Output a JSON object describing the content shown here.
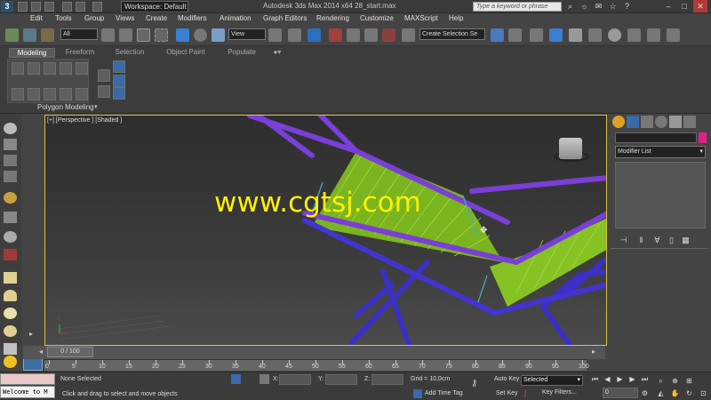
{
  "titlebar": {
    "workspace": "Workspace: Default",
    "title": "Autodesk 3ds Max  2014 x64      28_start.max",
    "search_placeholder": "Type a keyword or phrase"
  },
  "menu": [
    "Edit",
    "Tools",
    "Group",
    "Views",
    "Create",
    "Modifiers",
    "Animation",
    "Graph Editors",
    "Rendering",
    "Customize",
    "MAXScript",
    "Help"
  ],
  "toolbar": {
    "filter_select": "All",
    "view_select": "View",
    "named_selection": "Create Selection Se"
  },
  "ribbon": {
    "tabs": [
      "Modeling",
      "Freeform",
      "Selection",
      "Object Paint",
      "Populate"
    ],
    "panel_label": "Polygon Modeling"
  },
  "viewport": {
    "label": "[+] [Perspective ] [Shaded ]",
    "watermark": "www.cgtsj.com"
  },
  "command_panel": {
    "modifier_list": "Modifier List",
    "object_color": "#e0208a"
  },
  "timeline": {
    "frame_display": "0 / 100",
    "ticks": [
      "0",
      "5",
      "10",
      "15",
      "20",
      "25",
      "30",
      "35",
      "40",
      "45",
      "50",
      "55",
      "60",
      "65",
      "70",
      "75",
      "80",
      "85",
      "90",
      "95",
      "100"
    ]
  },
  "status": {
    "maxscript": "Welcome to M",
    "selection": "None Selected",
    "prompt": "Click and drag to select and move objects",
    "x_label": "X:",
    "y_label": "Y:",
    "z_label": "Z:",
    "grid": "Grid = 10,0cm",
    "add_time_tag": "Add Time Tag",
    "auto_key": "Auto Key",
    "set_key": "Set Key",
    "selected_dropdown": "Selected",
    "key_filters": "Key Filters...",
    "frame": "0"
  },
  "colors": {
    "viewport_border": "#d9c33b",
    "chair_frame": "#7a3fd6",
    "chair_frame_lower": "#3b2fc8",
    "weave": "#8bc320",
    "watermark": "#fff000"
  }
}
